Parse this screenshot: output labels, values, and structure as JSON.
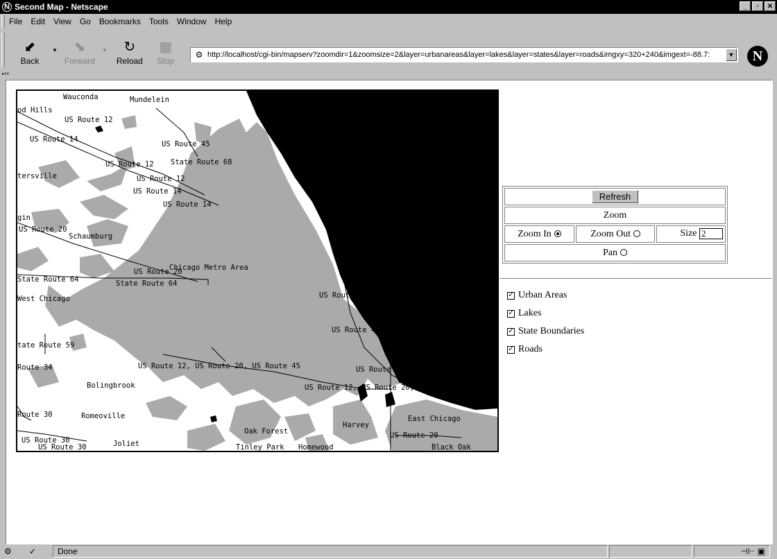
{
  "window": {
    "title": "Second Map - Netscape"
  },
  "menu": [
    "File",
    "Edit",
    "View",
    "Go",
    "Bookmarks",
    "Tools",
    "Window",
    "Help"
  ],
  "toolbar": {
    "back": "Back",
    "forward": "Forward",
    "reload": "Reload",
    "stop": "Stop"
  },
  "urlbar": {
    "url": "http://localhost/cgi-bin/mapserv?zoomdir=1&zoomsize=2&layer=urbanareas&layer=lakes&layer=states&layer=roads&imgxy=320+240&imgext=-88.7:"
  },
  "map": {
    "labels": [
      {
        "text": "Wauconda"
      },
      {
        "text": "Mundelein"
      },
      {
        "text": "od Hills"
      },
      {
        "text": "US Route 12"
      },
      {
        "text": "US Route 14"
      },
      {
        "text": "US Route 45"
      },
      {
        "text": "US Route 12"
      },
      {
        "text": "State Route 68"
      },
      {
        "text": "tersville"
      },
      {
        "text": "US Route 12"
      },
      {
        "text": "US Route 14"
      },
      {
        "text": "US Route 14"
      },
      {
        "text": "gin"
      },
      {
        "text": "US Route 20"
      },
      {
        "text": "Schaumburg"
      },
      {
        "text": "US Route 20"
      },
      {
        "text": "Chicago Metro Area"
      },
      {
        "text": "State Route 64"
      },
      {
        "text": "State Route 64"
      },
      {
        "text": "West Chicago"
      },
      {
        "text": "US Route 41"
      },
      {
        "text": "US Route 41"
      },
      {
        "text": "tate Route 59"
      },
      {
        "text": "Route 34"
      },
      {
        "text": "US Route 12, US Route 20, US Route 45"
      },
      {
        "text": "US Route 41"
      },
      {
        "text": "Bolingbrook"
      },
      {
        "text": "US Route 12, US Route 20, US Route 41"
      },
      {
        "text": "Route 30"
      },
      {
        "text": "Romeoville"
      },
      {
        "text": "Harvey"
      },
      {
        "text": "East Chicago"
      },
      {
        "text": "Oak Forest"
      },
      {
        "text": "US Route 30"
      },
      {
        "text": "Joliet"
      },
      {
        "text": "US Route 20"
      },
      {
        "text": "US Route 30"
      },
      {
        "text": "Tinley Park"
      },
      {
        "text": "Homewood"
      },
      {
        "text": "Black Oak"
      }
    ]
  },
  "controls": {
    "refresh": "Refresh",
    "zoom_header": "Zoom",
    "zoom_in": "Zoom In",
    "zoom_out": "Zoom Out",
    "size_label": "Size",
    "size_value": "2",
    "pan": "Pan",
    "selected_mode": "zoom_in"
  },
  "layers": [
    {
      "label": "Urban Areas",
      "checked": true
    },
    {
      "label": "Lakes",
      "checked": true
    },
    {
      "label": "State Boundaries",
      "checked": true
    },
    {
      "label": "Roads",
      "checked": true
    }
  ],
  "status": {
    "text": "Done"
  }
}
